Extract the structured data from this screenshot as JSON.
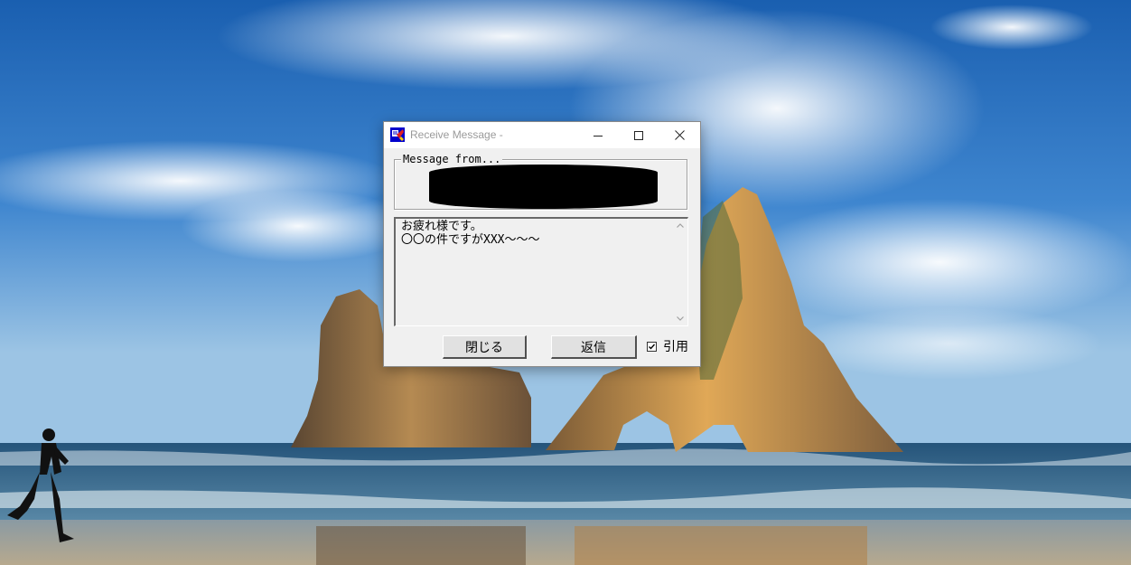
{
  "window": {
    "title": "Receive Message -",
    "accent_color": "#0000cc"
  },
  "sender_group": {
    "legend": "Message from...",
    "sender_redacted": true
  },
  "message": {
    "lines": [
      "お疲れ様です。",
      "〇〇の件ですがXXX～～～"
    ]
  },
  "buttons": {
    "close_label": "閉じる",
    "reply_label": "返信"
  },
  "quote": {
    "label": "引用",
    "checked": true
  },
  "icons": {
    "app": "message-app-icon",
    "minimize": "minimize-icon",
    "maximize": "maximize-icon",
    "close": "close-icon",
    "scroll_up": "chevron-up-icon",
    "scroll_down": "chevron-down-icon",
    "check": "checkmark-icon"
  }
}
